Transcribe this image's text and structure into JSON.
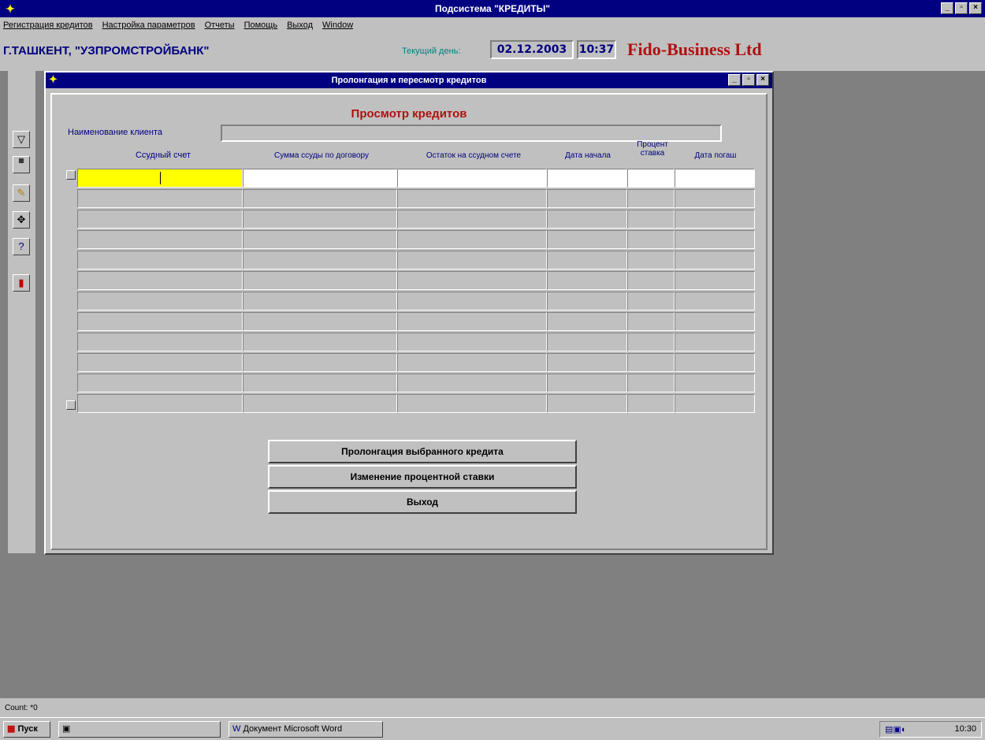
{
  "window": {
    "title": "Подсистема \"КРЕДИТЫ\"",
    "min": "_",
    "max": "▫",
    "close": "×"
  },
  "menu": [
    {
      "label": "Регистрация кредитов"
    },
    {
      "label": "Настройка параметров"
    },
    {
      "label": "Отчеты"
    },
    {
      "label": "Помощь"
    },
    {
      "label": "Выход"
    },
    {
      "label": "Window"
    }
  ],
  "info": {
    "city": "Г.ТАШКЕНТ, \"УЗПРОМСТРОЙБАНК\"",
    "current_day_label": "Текущий день:",
    "current_date": "02.12.2003",
    "current_time": "10:37",
    "brand": "Fido-Business Ltd"
  },
  "child": {
    "title": "Пролонгация и пересмотр кредитов",
    "form_title": "Просмотр кредитов",
    "client_label": "Наименование клиента",
    "client_value": "",
    "columns": {
      "c1": "Ссудный счет",
      "c2": "Сумма ссуды по договору",
      "c3": "Остаток на ссудном счете",
      "c4": "Дата начала",
      "c5": "Процент ставка",
      "c6": "Дата погаш"
    },
    "buttons": {
      "prolong": "Пролонгация выбранного кредита",
      "rate": "Изменение процентной ставки",
      "exit": "Выход"
    }
  },
  "status": {
    "text": "Count: *0"
  },
  "taskbar": {
    "start": "Пуск",
    "word_task": "Документ Microsoft Word",
    "clock": "10:30"
  },
  "icons": [
    "filter-icon",
    "sbl-icon",
    "note-icon",
    "move-icon",
    "help-icon",
    "exit-door-icon"
  ]
}
